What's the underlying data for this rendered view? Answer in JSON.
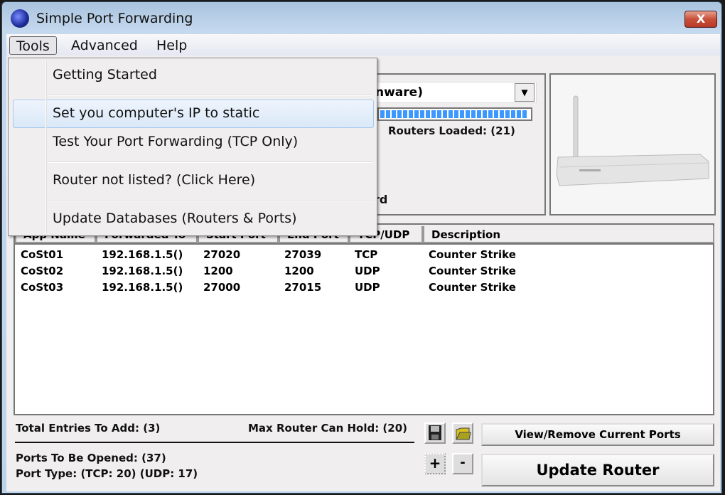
{
  "window": {
    "title": "Simple Port Forwarding",
    "close_label": "X"
  },
  "menubar": {
    "items": [
      "Tools",
      "Advanced",
      "Help"
    ]
  },
  "tools_menu": {
    "items": [
      "Getting Started",
      "Set you computer's IP to static",
      "Test Your Port Forwarding (TCP Only)",
      "Router not listed? (Click Here)",
      "Update Databases (Routers & Ports)"
    ],
    "highlighted": "Set you computer's IP to static"
  },
  "router": {
    "selected_partial": "nware)",
    "progress_percent": 100,
    "routers_loaded": "Routers Loaded: (21)",
    "partial_label": "ord"
  },
  "table": {
    "columns": [
      "App Name",
      "Forwarded To",
      "Start Port",
      "End Port",
      "TCP/UDP",
      "Description"
    ],
    "rows": [
      [
        "CoSt01",
        "192.168.1.5()",
        "27020",
        "27039",
        "TCP",
        "Counter Strike"
      ],
      [
        "CoSt02",
        "192.168.1.5()",
        "1200",
        "1200",
        "UDP",
        "Counter Strike"
      ],
      [
        "CoSt03",
        "192.168.1.5()",
        "27000",
        "27015",
        "UDP",
        "Counter Strike"
      ]
    ]
  },
  "footer": {
    "total_entries": "Total Entries To Add: (3)",
    "max_hold": "Max Router Can Hold: (20)",
    "ports_opened": "Ports To Be Opened: (37)",
    "port_type": "Port Type: (TCP: 20) (UDP: 17)",
    "view_remove": "View/Remove Current Ports",
    "update_router": "Update Router",
    "add": "+",
    "remove": "-"
  },
  "colors": {
    "progress": "#3c98ff",
    "highlight": "#dae8f8",
    "close": "#c8503a"
  }
}
